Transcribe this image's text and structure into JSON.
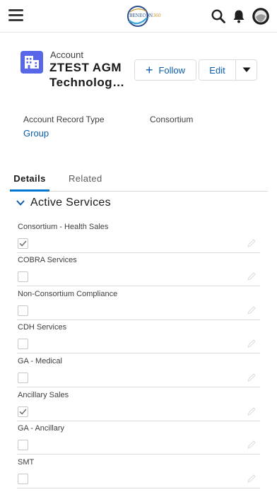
{
  "topbar": {
    "logo_text": "BENECON",
    "logo_accent": "360"
  },
  "record": {
    "object_label": "Account",
    "name_line1": "ZTEST AGM",
    "name_line2": "Technolog…",
    "follow_label": "Follow",
    "edit_label": "Edit"
  },
  "highlights": [
    {
      "label": "Account Record Type",
      "value": "Group"
    },
    {
      "label": "Consortium",
      "value": ""
    }
  ],
  "tabs": [
    {
      "label": "Details",
      "active": true
    },
    {
      "label": "Related",
      "active": false
    }
  ],
  "section": {
    "title": "Active Services",
    "expanded": true
  },
  "services": [
    {
      "label": "Consortium - Health Sales",
      "checked": true
    },
    {
      "label": "COBRA Services",
      "checked": false
    },
    {
      "label": "Non-Consortium Compliance",
      "checked": false
    },
    {
      "label": "CDH Services",
      "checked": false
    },
    {
      "label": "GA - Medical",
      "checked": false
    },
    {
      "label": "Ancillary Sales",
      "checked": true
    },
    {
      "label": "GA - Ancillary",
      "checked": false
    },
    {
      "label": "SMT",
      "checked": false
    }
  ],
  "colors": {
    "brand_blue": "#0176d3",
    "link_blue": "#0b5cab",
    "account_icon": "#5867e8",
    "border": "#dddbda"
  },
  "icons": {
    "menu": "hamburger-icon",
    "search": "search-icon",
    "notifications": "bell-icon",
    "avatar": "avatar",
    "account": "building-icon",
    "more": "chevron-down-icon",
    "section": "chevron-down-icon",
    "edit_field": "pencil-icon",
    "checked": "checkmark-icon"
  }
}
